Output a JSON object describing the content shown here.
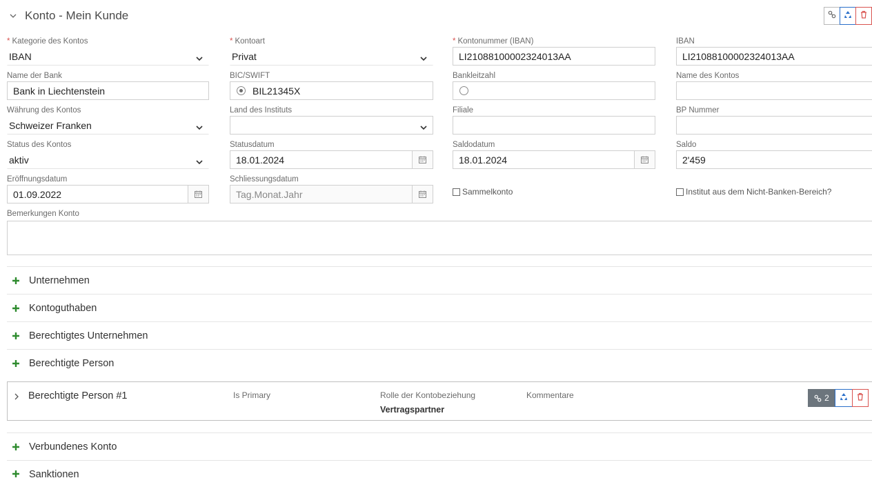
{
  "header": {
    "title": "Konto - Mein Kunde"
  },
  "top_actions": [
    {
      "icon": "link-icon"
    },
    {
      "icon": "recycle-icon"
    },
    {
      "icon": "trash-icon"
    }
  ],
  "fields": {
    "kategorie": {
      "label": "Kategorie des Kontos",
      "value": "IBAN",
      "required": "*"
    },
    "kontoart": {
      "label": "Kontoart",
      "value": "Privat",
      "required": "*"
    },
    "kontonummer": {
      "label": "Kontonummer (IBAN)",
      "value": "LI21088100002324013AA",
      "required": "*"
    },
    "iban": {
      "label": "IBAN",
      "value": "LI21088100002324013AA"
    },
    "name_bank": {
      "label": "Name der Bank",
      "value": "Bank in Liechtenstein"
    },
    "bic": {
      "label": "BIC/SWIFT",
      "value": "BIL21345X"
    },
    "bankleitzahl": {
      "label": "Bankleitzahl",
      "value": ""
    },
    "name_konto": {
      "label": "Name des Kontos",
      "value": ""
    },
    "waehrung": {
      "label": "Währung des Kontos",
      "value": "Schweizer Franken"
    },
    "land": {
      "label": "Land des Instituts",
      "value": ""
    },
    "filiale": {
      "label": "Filiale",
      "value": ""
    },
    "bp_nummer": {
      "label": "BP Nummer",
      "value": ""
    },
    "status": {
      "label": "Status des Kontos",
      "value": "aktiv"
    },
    "statusdatum": {
      "label": "Statusdatum",
      "value": "18.01.2024"
    },
    "saldodatum": {
      "label": "Saldodatum",
      "value": "18.01.2024"
    },
    "saldo": {
      "label": "Saldo",
      "value": "2'459"
    },
    "eroeffnung": {
      "label": "Eröffnungsdatum",
      "value": "01.09.2022"
    },
    "schliessung": {
      "label": "Schliessungsdatum",
      "placeholder": "Tag.Monat.Jahr"
    },
    "bemerkungen": {
      "label": "Bemerkungen Konto",
      "value": ""
    }
  },
  "checkboxes": {
    "sammelkonto": {
      "label": "Sammelkonto",
      "checked": false
    },
    "nicht_banken": {
      "label": "Institut aus dem Nicht-Banken-Bereich?",
      "checked": false
    }
  },
  "sections": [
    {
      "label": "Unternehmen"
    },
    {
      "label": "Kontoguthaben"
    },
    {
      "label": "Berechtigtes Unternehmen"
    },
    {
      "label": "Berechtigte Person"
    },
    {
      "label": "Verbundenes Konto"
    },
    {
      "label": "Sanktionen"
    }
  ],
  "person_panel": {
    "title": "Berechtigte Person #1",
    "col_primary": "Is Primary",
    "col_rolle": "Rolle der Kontobeziehung",
    "rolle_value": "Vertragspartner",
    "col_kommentare": "Kommentare",
    "link_count": "2"
  },
  "colors": {
    "accent_green": "#2e8b2e",
    "accent_blue": "#2a6fc9",
    "danger": "#d9534f"
  }
}
